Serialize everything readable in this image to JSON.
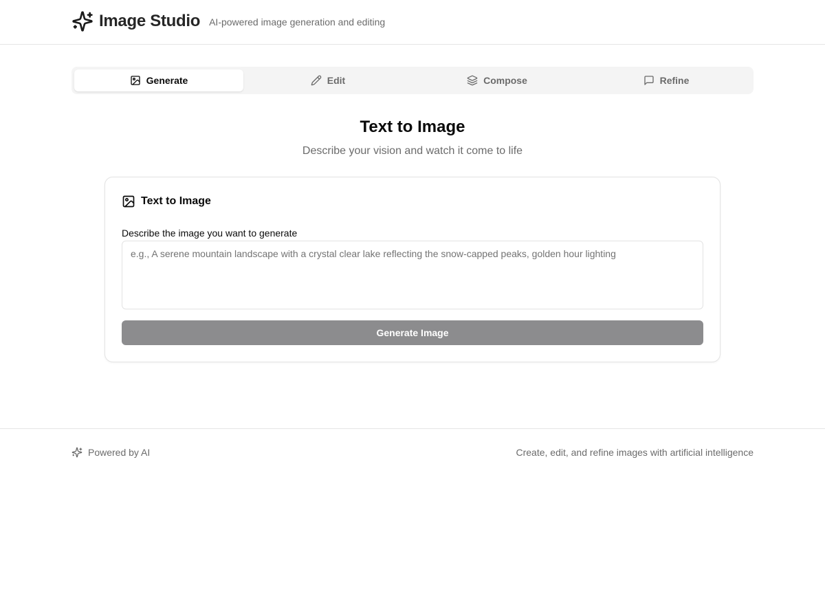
{
  "header": {
    "title": "Image Studio",
    "subtitle": "AI-powered image generation and editing",
    "logo_icon": "sparkles-icon"
  },
  "tabs": [
    {
      "label": "Generate",
      "icon": "image-icon",
      "active": true
    },
    {
      "label": "Edit",
      "icon": "pencil-icon",
      "active": false
    },
    {
      "label": "Compose",
      "icon": "layers-icon",
      "active": false
    },
    {
      "label": "Refine",
      "icon": "message-square-icon",
      "active": false
    }
  ],
  "main": {
    "heading": "Text to Image",
    "subheading": "Describe your vision and watch it come to life"
  },
  "card": {
    "title": "Text to Image",
    "icon": "image-icon",
    "field_label": "Describe the image you want to generate",
    "prompt_value": "",
    "prompt_placeholder": "e.g., A serene mountain landscape with a crystal clear lake reflecting the snow-capped peaks, golden hour lighting",
    "button_label": "Generate Image",
    "button_disabled": true
  },
  "footer": {
    "left_text": "Powered by AI",
    "left_icon": "sparkles-icon",
    "right_text": "Create, edit, and refine images with artificial intelligence"
  },
  "colors": {
    "border": "#e5e5e5",
    "muted_text": "#6b6b6b",
    "tab_bar_bg": "#f4f4f4",
    "button_disabled_bg": "#8c8c8e"
  }
}
